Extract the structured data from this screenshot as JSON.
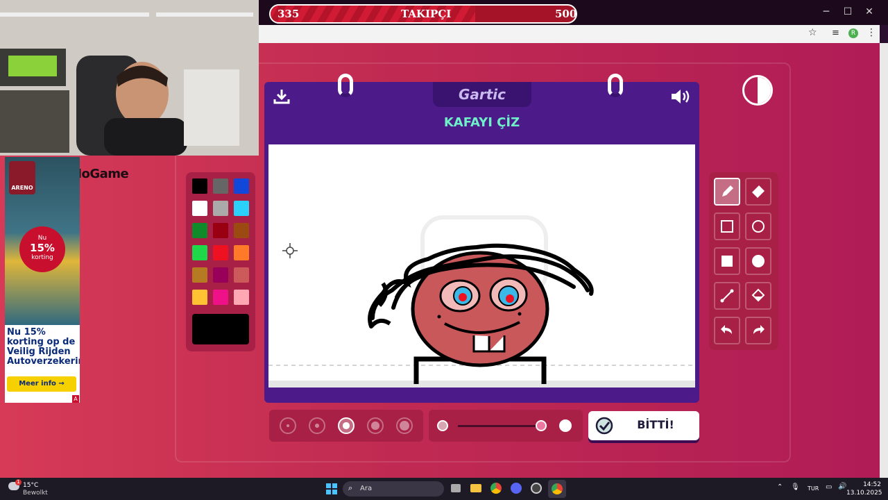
{
  "stream": {
    "follower_current": "335",
    "follower_label": "TAKIPÇI",
    "follower_goal": "500",
    "follower_progress": 0.67,
    "streamer_name": "BiNoGame"
  },
  "window": {
    "minimize": "─",
    "maximize": "☐",
    "close": "✕"
  },
  "ad": {
    "logo": "ARENO",
    "badge_line1": "Nu",
    "badge_line2": "15%",
    "badge_line3": "korting",
    "text": "Nu 15% korting op de Veilig Rijden Autoverzekering",
    "button": "Meer info →",
    "adchoice": "A"
  },
  "game": {
    "logo": "Gartic",
    "prompt": "KAFAYI ÇİZ",
    "done_label": "BİTTİ!",
    "colors": {
      "card": "#4d1a8a",
      "accent_prompt": "#6ff0c8",
      "panel": "#a82046"
    },
    "palette": [
      "#000000",
      "#666666",
      "#1148d9",
      "#ffffff",
      "#aaaaaa",
      "#2ad2fb",
      "#118a2a",
      "#990011",
      "#9b4a12",
      "#1fd84a",
      "#ee1122",
      "#ff7a28",
      "#b67a22",
      "#99005a",
      "#cc5a5a",
      "#ffc233",
      "#ee1188",
      "#ffa8b4"
    ],
    "current_color": "#000000",
    "tools": [
      "pencil-icon",
      "eraser-icon",
      "square-outline-icon",
      "circle-outline-icon",
      "square-fill-icon",
      "circle-fill-icon",
      "line-icon",
      "fill-bucket-icon",
      "undo-icon",
      "redo-icon"
    ],
    "active_tool": "pencil-icon",
    "brush_sizes": [
      1,
      2,
      3,
      4,
      5
    ],
    "selected_brush": 3,
    "opacity_level": 0.95
  },
  "taskbar": {
    "weather_temp": "15°C",
    "weather_desc": "Bewolkt",
    "weather_badge": "1",
    "search": "Ara",
    "lang": "TUR",
    "time": "14:52",
    "date": "13.10.2025"
  }
}
